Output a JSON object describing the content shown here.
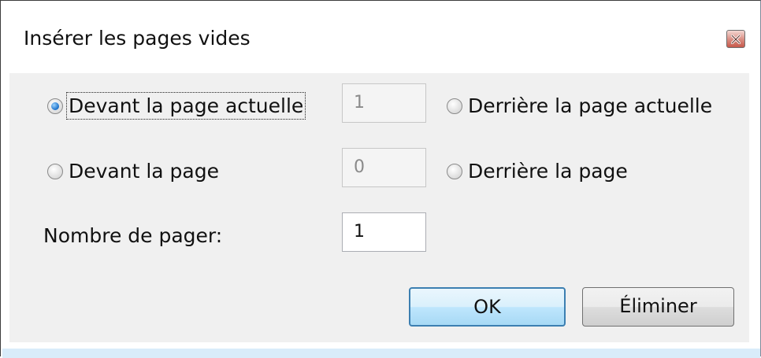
{
  "dialog": {
    "title": "Insérer les pages vides",
    "close_icon": "close-icon"
  },
  "options": {
    "before_current": {
      "label": "Devant la page actuelle",
      "checked": true
    },
    "after_current": {
      "label": "Derrière la page actuelle",
      "checked": false
    },
    "before_page": {
      "label": "Devant la page",
      "checked": false
    },
    "after_page": {
      "label": "Derrière la page",
      "checked": false
    }
  },
  "fields": {
    "current_page": {
      "value": "1",
      "enabled": false
    },
    "page_number": {
      "value": "0",
      "enabled": false
    },
    "count": {
      "label": "Nombre de pager:",
      "value": "1",
      "enabled": true
    }
  },
  "buttons": {
    "ok": "OK",
    "cancel": "Éliminer"
  }
}
